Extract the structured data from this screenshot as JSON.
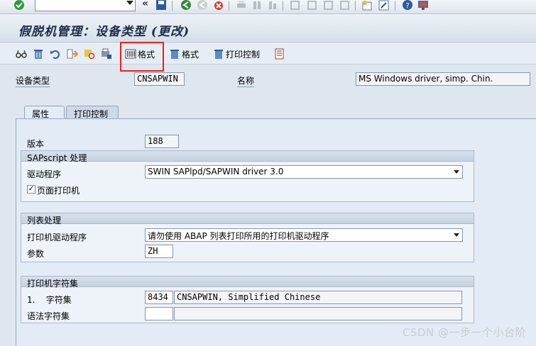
{
  "title": "假脱机管理：设备类型 (更改)",
  "system_toolbar": {
    "command_field": ""
  },
  "app_toolbar": {
    "btn_format_1": "格式",
    "btn_format_2": "格式",
    "btn_print_control": "打印控制"
  },
  "header": {
    "device_type_label": "设备类型",
    "device_type_value": "CNSAPWIN",
    "name_label": "名称",
    "name_value": "MS Windows driver, simp. Chin."
  },
  "tabs": [
    {
      "label": "属性",
      "active": true
    },
    {
      "label": "打印控制",
      "active": false
    }
  ],
  "attributes": {
    "version_label": "版本",
    "version_value": "188",
    "sapscript": {
      "title": "SAPscript 处理",
      "driver_label": "驱动程序",
      "driver_value": "SWIN SAPlpd/SAPWIN driver 3.0",
      "page_printer_label": "页面打印机",
      "page_printer_checked": "✓"
    },
    "list_processing": {
      "title": "列表处理",
      "printer_driver_label": "打印机驱动程序",
      "printer_driver_value": "请勿使用 ABAP 列表打印所用的打印机驱动程序",
      "param_label": "参数",
      "param_value": "ZH"
    },
    "charset": {
      "title": "打印机字符集",
      "charset_label": "1.    字符集",
      "charset_code": "8434",
      "charset_desc": "CNSAPWIN, Simplified Chinese",
      "grammar_label": "语法字符集",
      "grammar_code": "",
      "grammar_desc": ""
    }
  },
  "watermark": "CSDN @一步一个小台阶",
  "colors": {
    "accent_red": "#e8231a",
    "panel_bg": "#e3ecf6"
  }
}
